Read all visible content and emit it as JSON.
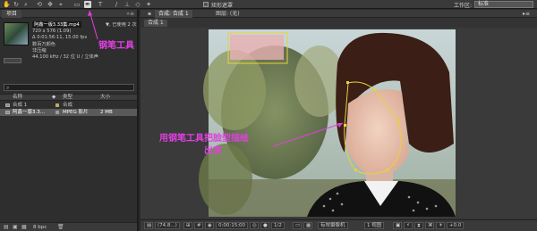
{
  "toolbar": {
    "tools": [
      "hand-icon",
      "rotate-icon",
      "zoom-icon",
      "orbit-icon",
      "pan-icon",
      "camera-icon",
      "rect-mask-icon",
      "pen-tool-icon",
      "text-icon",
      "brush-icon",
      "clone-icon",
      "eraser-icon",
      "puppet-icon"
    ],
    "auto_open_label": "矩形遮罩",
    "workspace_label": "工作区:",
    "workspace_value": "标准"
  },
  "project": {
    "tab_label": "项目",
    "file_name": "阿鑫一版3.33集.mp4",
    "used": "▼, 已使用 2 次",
    "info_lines": [
      "720 x 576 (1.09)",
      "Δ 0:01:56:11, 15.00 fps",
      "数百万颜色",
      "非压缩",
      "44.100 kHz / 32 位 U / 立体声"
    ],
    "search_placeholder": "",
    "columns": [
      "名称",
      "类型",
      "大小"
    ],
    "rows": [
      {
        "name": "合成 1",
        "type": "合成",
        "size": ""
      },
      {
        "name": "阿鑫一版3.3...",
        "type": "MPEG 影片",
        "size": "2 MB"
      }
    ],
    "bpc": "8 bpc"
  },
  "composition": {
    "tabs": [
      "合成: 合成 1",
      "图层: (无)"
    ],
    "subtab": "合成 1",
    "bottom": {
      "zoom": "(74.8...)",
      "time": "0;00;15;00",
      "resolution": "1/2",
      "camera": "有效摄像机",
      "views": "1 视图",
      "offset": "+0.0"
    }
  },
  "annotations": {
    "pen_tool": "钢笔工具",
    "trace": "用钢笔工具把脸型描绘",
    "trace2": "出来"
  },
  "colors": {
    "annotation": "#e040e0",
    "mask_path": "#e8d23a"
  }
}
